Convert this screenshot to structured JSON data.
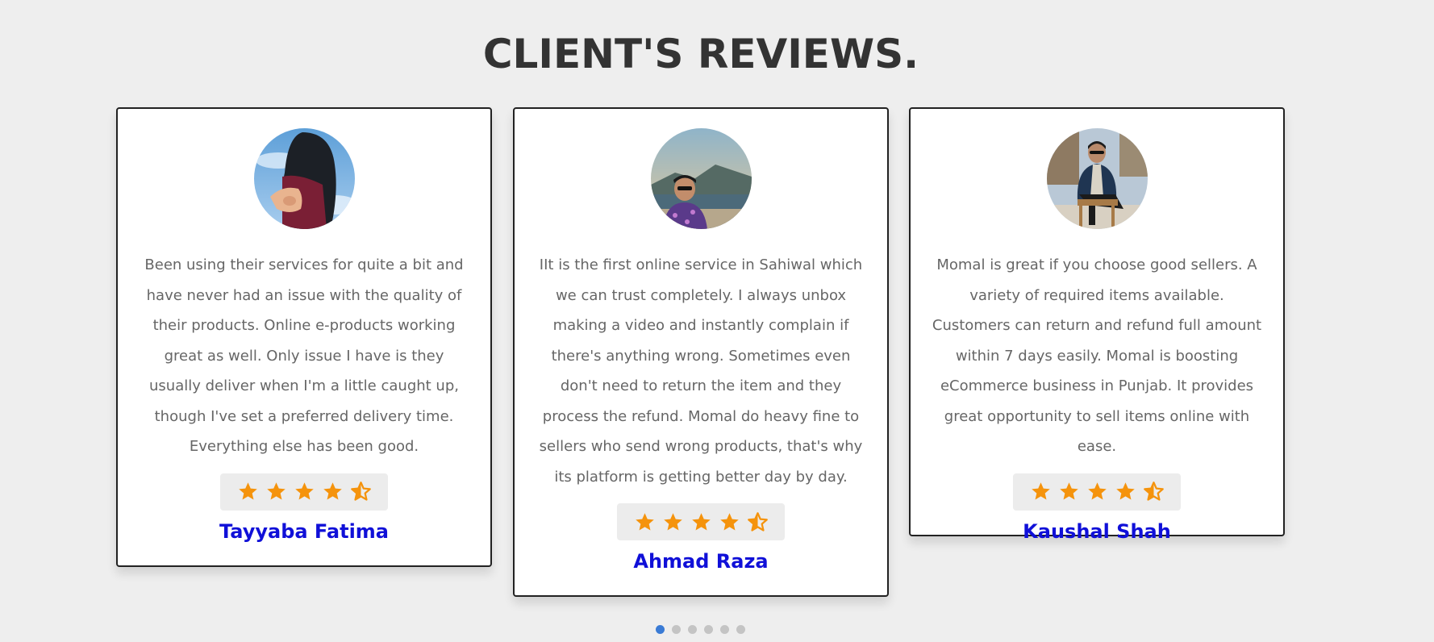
{
  "section_title": "CLIENT'S REVIEWS.",
  "colors": {
    "star": "#f5930c",
    "name": "#1010d8",
    "active_dot": "#3a7bd5"
  },
  "reviews": [
    {
      "text": "Been using their services for quite a bit and have never had an issue with the quality of their products. Online e-products working great as well. Only issue I have is they usually deliver when I'm a little caught up, though I've set a preferred delivery time. Everything else has been good.",
      "rating": 4.5,
      "name": "Tayyaba Fatima"
    },
    {
      "text": "IIt is the first online service in Sahiwal which we can trust completely. I always unbox making a video and instantly complain if there's anything wrong. Sometimes even don't need to return the item and they process the refund. Momal do heavy fine to sellers who send wrong products, that's why its platform is getting better day by day.",
      "rating": 4.5,
      "name": "Ahmad Raza"
    },
    {
      "text": "Momal is great if you choose good sellers. A variety of required items available. Customers can return and refund full amount within 7 days easily. Momal is boosting eCommerce business in Punjab. It provides great opportunity to sell items online with ease.",
      "rating": 4.5,
      "name": "Kaushal Shah"
    }
  ],
  "carousel": {
    "total_pages": 6,
    "active_index": 0
  }
}
